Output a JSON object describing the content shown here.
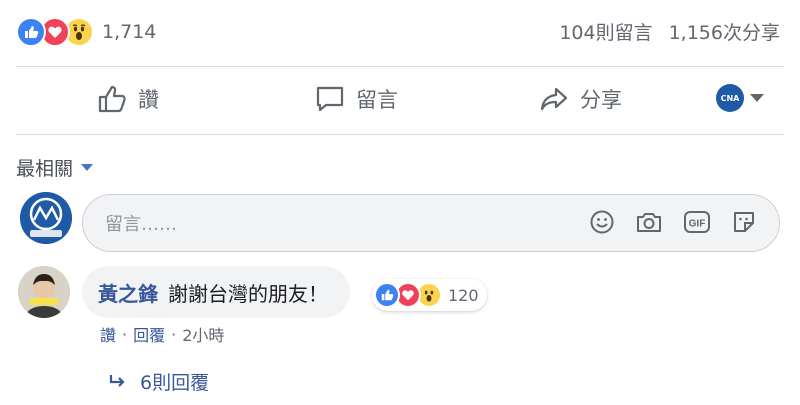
{
  "stats": {
    "reaction_count": "1,714",
    "comments": "104則留言",
    "shares": "1,156次分享",
    "reactions": [
      "like-icon",
      "love-icon",
      "wow-icon"
    ]
  },
  "actions": {
    "like": "讚",
    "comment": "留言",
    "share": "分享"
  },
  "page_switch": {
    "avatar_text": "CNA"
  },
  "sort": {
    "label": "最相關"
  },
  "composer": {
    "placeholder": "留言……",
    "icons": [
      "emoji-icon",
      "camera-icon",
      "gif-icon",
      "sticker-icon"
    ]
  },
  "comment": {
    "author": "黃之鋒",
    "text": "謝謝台灣的朋友！",
    "reaction_count": "120",
    "reactions": [
      "like-icon",
      "love-icon",
      "wow-icon"
    ],
    "like_label": "讚",
    "separator": "·",
    "reply_label": "回覆",
    "time": "2小時",
    "replies_label": "6則回覆"
  },
  "colors": {
    "link": "#385898",
    "like": "#3b82f2",
    "love": "#f0405a",
    "wow": "#fcd34d",
    "muted": "#606770"
  }
}
